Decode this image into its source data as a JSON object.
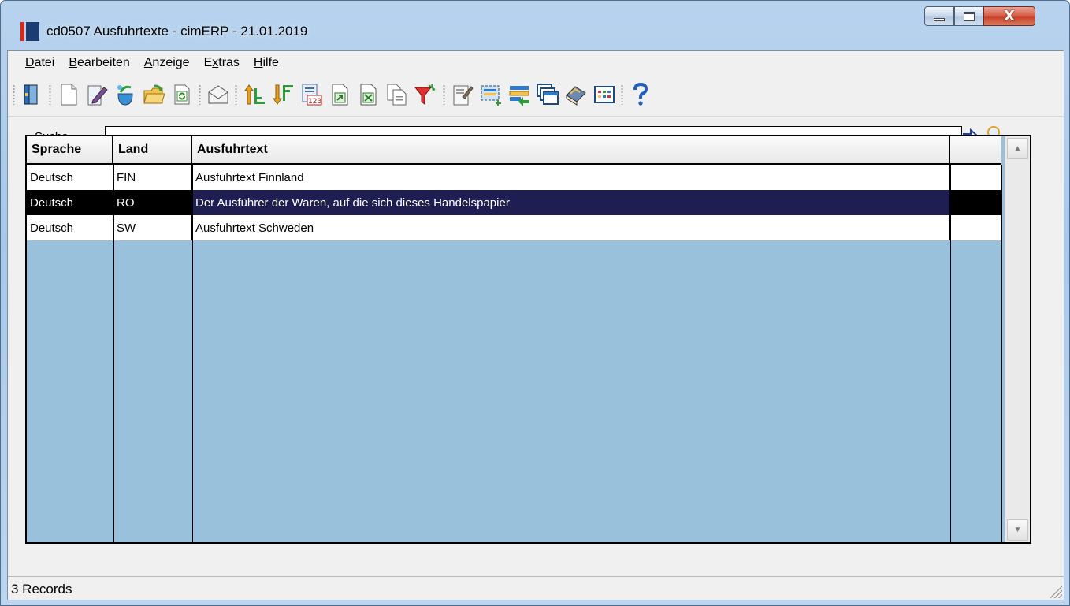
{
  "window": {
    "title": "cd0507 Ausfuhrtexte - cimERP - 21.01.2019",
    "controls": {
      "minimize": "minimize",
      "maximize": "maximize",
      "close": "X"
    }
  },
  "menu": [
    {
      "label": "Datei",
      "accel": "D",
      "rest": "atei"
    },
    {
      "label": "Bearbeiten",
      "accel": "B",
      "rest": "earbeiten"
    },
    {
      "label": "Anzeige",
      "accel": "A",
      "rest": "nzeige"
    },
    {
      "label": "Extras",
      "pre": "E",
      "accel": "x",
      "rest": "tras"
    },
    {
      "label": "Hilfe",
      "accel": "H",
      "rest": "ilfe"
    }
  ],
  "toolbar": {
    "icons": [
      "exit-icon",
      "new-document-icon",
      "edit-icon",
      "copy-record-icon",
      "open-folder-icon",
      "refresh-icon",
      "email-icon",
      "sort-ascending-icon",
      "sort-descending-icon",
      "numbering-icon",
      "export-icon",
      "excel-export-icon",
      "copy-pages-icon",
      "filter-icon",
      "properties-icon",
      "select-area-icon",
      "transfer-icon",
      "windows-icon",
      "books-icon",
      "grid-view-icon",
      "help-icon"
    ]
  },
  "search": {
    "label": "Suche",
    "value": "",
    "go_icon": "arrow-right-icon",
    "find_icon": "magnifier-icon"
  },
  "grid": {
    "columns": [
      "Sprache",
      "Land",
      "Ausfuhrtext",
      ""
    ],
    "rows": [
      {
        "sprache": "Deutsch",
        "land": "FIN",
        "text": "Ausfuhrtext Finnland",
        "selected": false
      },
      {
        "sprache": "Deutsch",
        "land": "RO",
        "text": "Der Ausführer der Waren, auf die sich dieses Handelspapier",
        "selected": true
      },
      {
        "sprache": "Deutsch",
        "land": "SW",
        "text": "Ausfuhrtext Schweden",
        "selected": false
      }
    ]
  },
  "status": {
    "text": "3 Records"
  },
  "colors": {
    "grid_background": "#9ac1db",
    "selection_text_cell": "#1e1e52",
    "selection": "#000000",
    "logo_red": "#d9261c",
    "logo_blue": "#1b3b73"
  }
}
